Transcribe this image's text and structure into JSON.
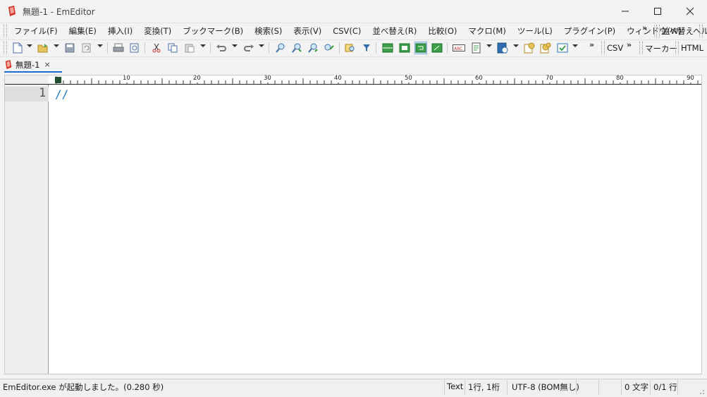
{
  "window": {
    "title": "無題-1 - EmEditor",
    "minimize_glyph": "─",
    "maximize_glyph": "☐",
    "close_glyph": "✕"
  },
  "menu": {
    "items": [
      {
        "label": "ファイル(F)"
      },
      {
        "label": "編集(E)"
      },
      {
        "label": "挿入(I)"
      },
      {
        "label": "変換(T)"
      },
      {
        "label": "ブックマーク(B)"
      },
      {
        "label": "検索(S)"
      },
      {
        "label": "表示(V)"
      },
      {
        "label": "CSV(C)"
      },
      {
        "label": "並べ替え(R)"
      },
      {
        "label": "比較(O)"
      },
      {
        "label": "マクロ(M)"
      },
      {
        "label": "ツール(L)"
      },
      {
        "label": "プラグイン(P)"
      },
      {
        "label": "ウィンドウ(W)"
      },
      {
        "label": "ヘル"
      }
    ],
    "overflow": "»",
    "sort_toolbar_label": "並べ替え"
  },
  "toolbar": {
    "overflow": "»",
    "csv_label": "CSV",
    "marker_label": "マーカー",
    "html_label": "HTML"
  },
  "tab": {
    "label": "無題-1",
    "close_glyph": "×"
  },
  "ruler": {
    "labels": [
      "10",
      "20",
      "30",
      "40",
      "50",
      "60",
      "70",
      "80",
      "90"
    ]
  },
  "editor": {
    "line_number": "1",
    "text": "//"
  },
  "statusbar": {
    "message": "EmEditor.exe が起動しました。(0.280 秒)",
    "mode": "Text",
    "position": "1行, 1桁",
    "encoding": "UTF-8 (BOM無し)",
    "char_count": "0 文字",
    "line_count": "0/1 行"
  },
  "colors": {
    "accent": "#1a6fd0",
    "text_blue": "#1f78c8",
    "app_icon_red": "#d52b1e"
  }
}
